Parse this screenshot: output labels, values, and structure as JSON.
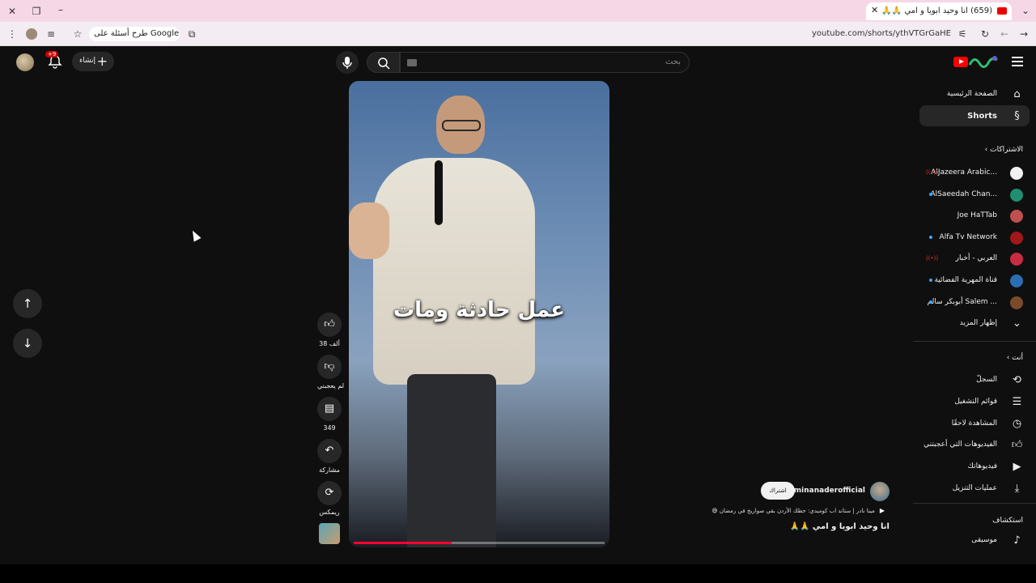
{
  "browser": {
    "tab_title": "(659) انا وحيد ابويا و امي 🙏🙏",
    "url": "youtube.com/shorts/ythVTGrGaHE",
    "search_chip": "طرح أسئلة على Google"
  },
  "header": {
    "search_placeholder": "بحث",
    "create_label": "إنشاء",
    "notifications_badge": "+9"
  },
  "sidebar": {
    "home_label": "الصفحة الرئيسية",
    "shorts_label": "Shorts",
    "subscriptions_heading": "الاشتراكات",
    "subscriptions": [
      {
        "name": "AlJazeera Arabic...",
        "color": "#f2f2f2",
        "live": true
      },
      {
        "name": "AlSaeedah Chan...",
        "color": "#1f8f6f",
        "dot": true
      },
      {
        "name": "Joe HaTTab",
        "color": "#c0504d"
      },
      {
        "name": "Alfa Tv Network",
        "color": "#a01818",
        "dot": true
      },
      {
        "name": "العربي - أخبار",
        "color": "#c72c41",
        "live": true
      },
      {
        "name": "قناة المهرية الفضائية",
        "color": "#2a6fb5",
        "dot": true
      },
      {
        "name": "أبوبكر سالم Salem ...",
        "color": "#7a4a2a",
        "dot": true
      }
    ],
    "show_more": "إظهار المزيد",
    "you_heading": "أنت",
    "you_items": [
      {
        "label": "السجلّ",
        "icon": "history-icon"
      },
      {
        "label": "قوائم التشغيل",
        "icon": "playlists-icon"
      },
      {
        "label": "المشاهدة لاحقًا",
        "icon": "watch-later-icon"
      },
      {
        "label": "الفيديوهات التي أعجبتني",
        "icon": "liked-icon"
      },
      {
        "label": "فيديوهاتك",
        "icon": "your-videos-icon"
      },
      {
        "label": "عمليات التنزيل",
        "icon": "downloads-icon"
      }
    ],
    "explore_heading": "استكشاف",
    "explore_items": [
      {
        "label": "موسيقى",
        "icon": "music-icon"
      }
    ]
  },
  "video": {
    "caption": "عمل حادثة ومات",
    "progress": 0.39,
    "channel": "@minanaderofficial",
    "subscribe": "اشتراك",
    "related": "مينا نادر | ستاند اب كوميدي: حظك الأردن بقي صواريخ في رمضان 😅",
    "title": "انا وحيد ابويا و امي 🙏🙏"
  },
  "actions": {
    "likes": "38 ألف",
    "dislike": "لم يعجبني",
    "comments": "349",
    "share": "مشاركة",
    "remix": "ريمكس"
  }
}
